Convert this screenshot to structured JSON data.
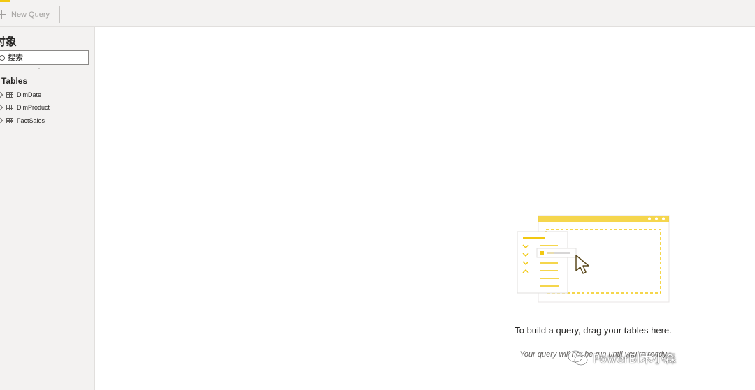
{
  "toolbar": {
    "new_query_label": "New Query"
  },
  "sidebar": {
    "title": "对象",
    "search_placeholder": "搜索",
    "section_label": "Tables",
    "tables": [
      {
        "label": "DimDate"
      },
      {
        "label": "DimProduct"
      },
      {
        "label": "FactSales"
      }
    ]
  },
  "canvas": {
    "empty_heading": "To build a query, drag your tables here.",
    "empty_subtext": "Your query will not be run until you're ready"
  },
  "watermark": {
    "text": "PowerBI木小森"
  },
  "colors": {
    "accent": "#f2c811",
    "panel_bg": "#f3f2f1",
    "border": "#e1dfdd"
  },
  "icons": [
    "plus-icon",
    "search-icon",
    "chevron-right-icon",
    "table-icon",
    "cursor-icon",
    "wechat-icon"
  ]
}
